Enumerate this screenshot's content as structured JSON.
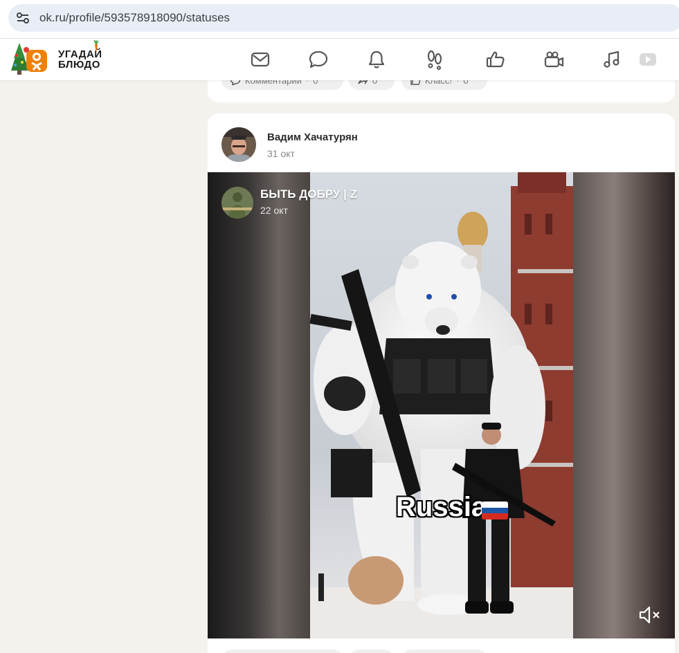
{
  "browser": {
    "url": "ok.ru/profile/593578918090/statuses"
  },
  "header": {
    "logo_line1": "УГАДАЙ",
    "logo_line2": "БЛЮДО",
    "nav_icons": [
      "mail-icon",
      "chat-icon",
      "bell-icon",
      "guests-icon",
      "like-icon",
      "video-camera-icon",
      "music-icon",
      "video-play-icon"
    ]
  },
  "previous_post": {
    "comments_label": "Комментарии",
    "comments_count": "0",
    "shares_count": "0",
    "likes_label": "Класс!",
    "likes_count": "0"
  },
  "post": {
    "author": "Вадим Хачатурян",
    "date": "31 окт",
    "reshared": {
      "group_name": "БЫТЬ ДОБРУ | Z",
      "date": "22 окт",
      "caption": "Russia"
    }
  },
  "colors": {
    "page_bg": "#f5f2ee",
    "accent": "#ee8208"
  }
}
